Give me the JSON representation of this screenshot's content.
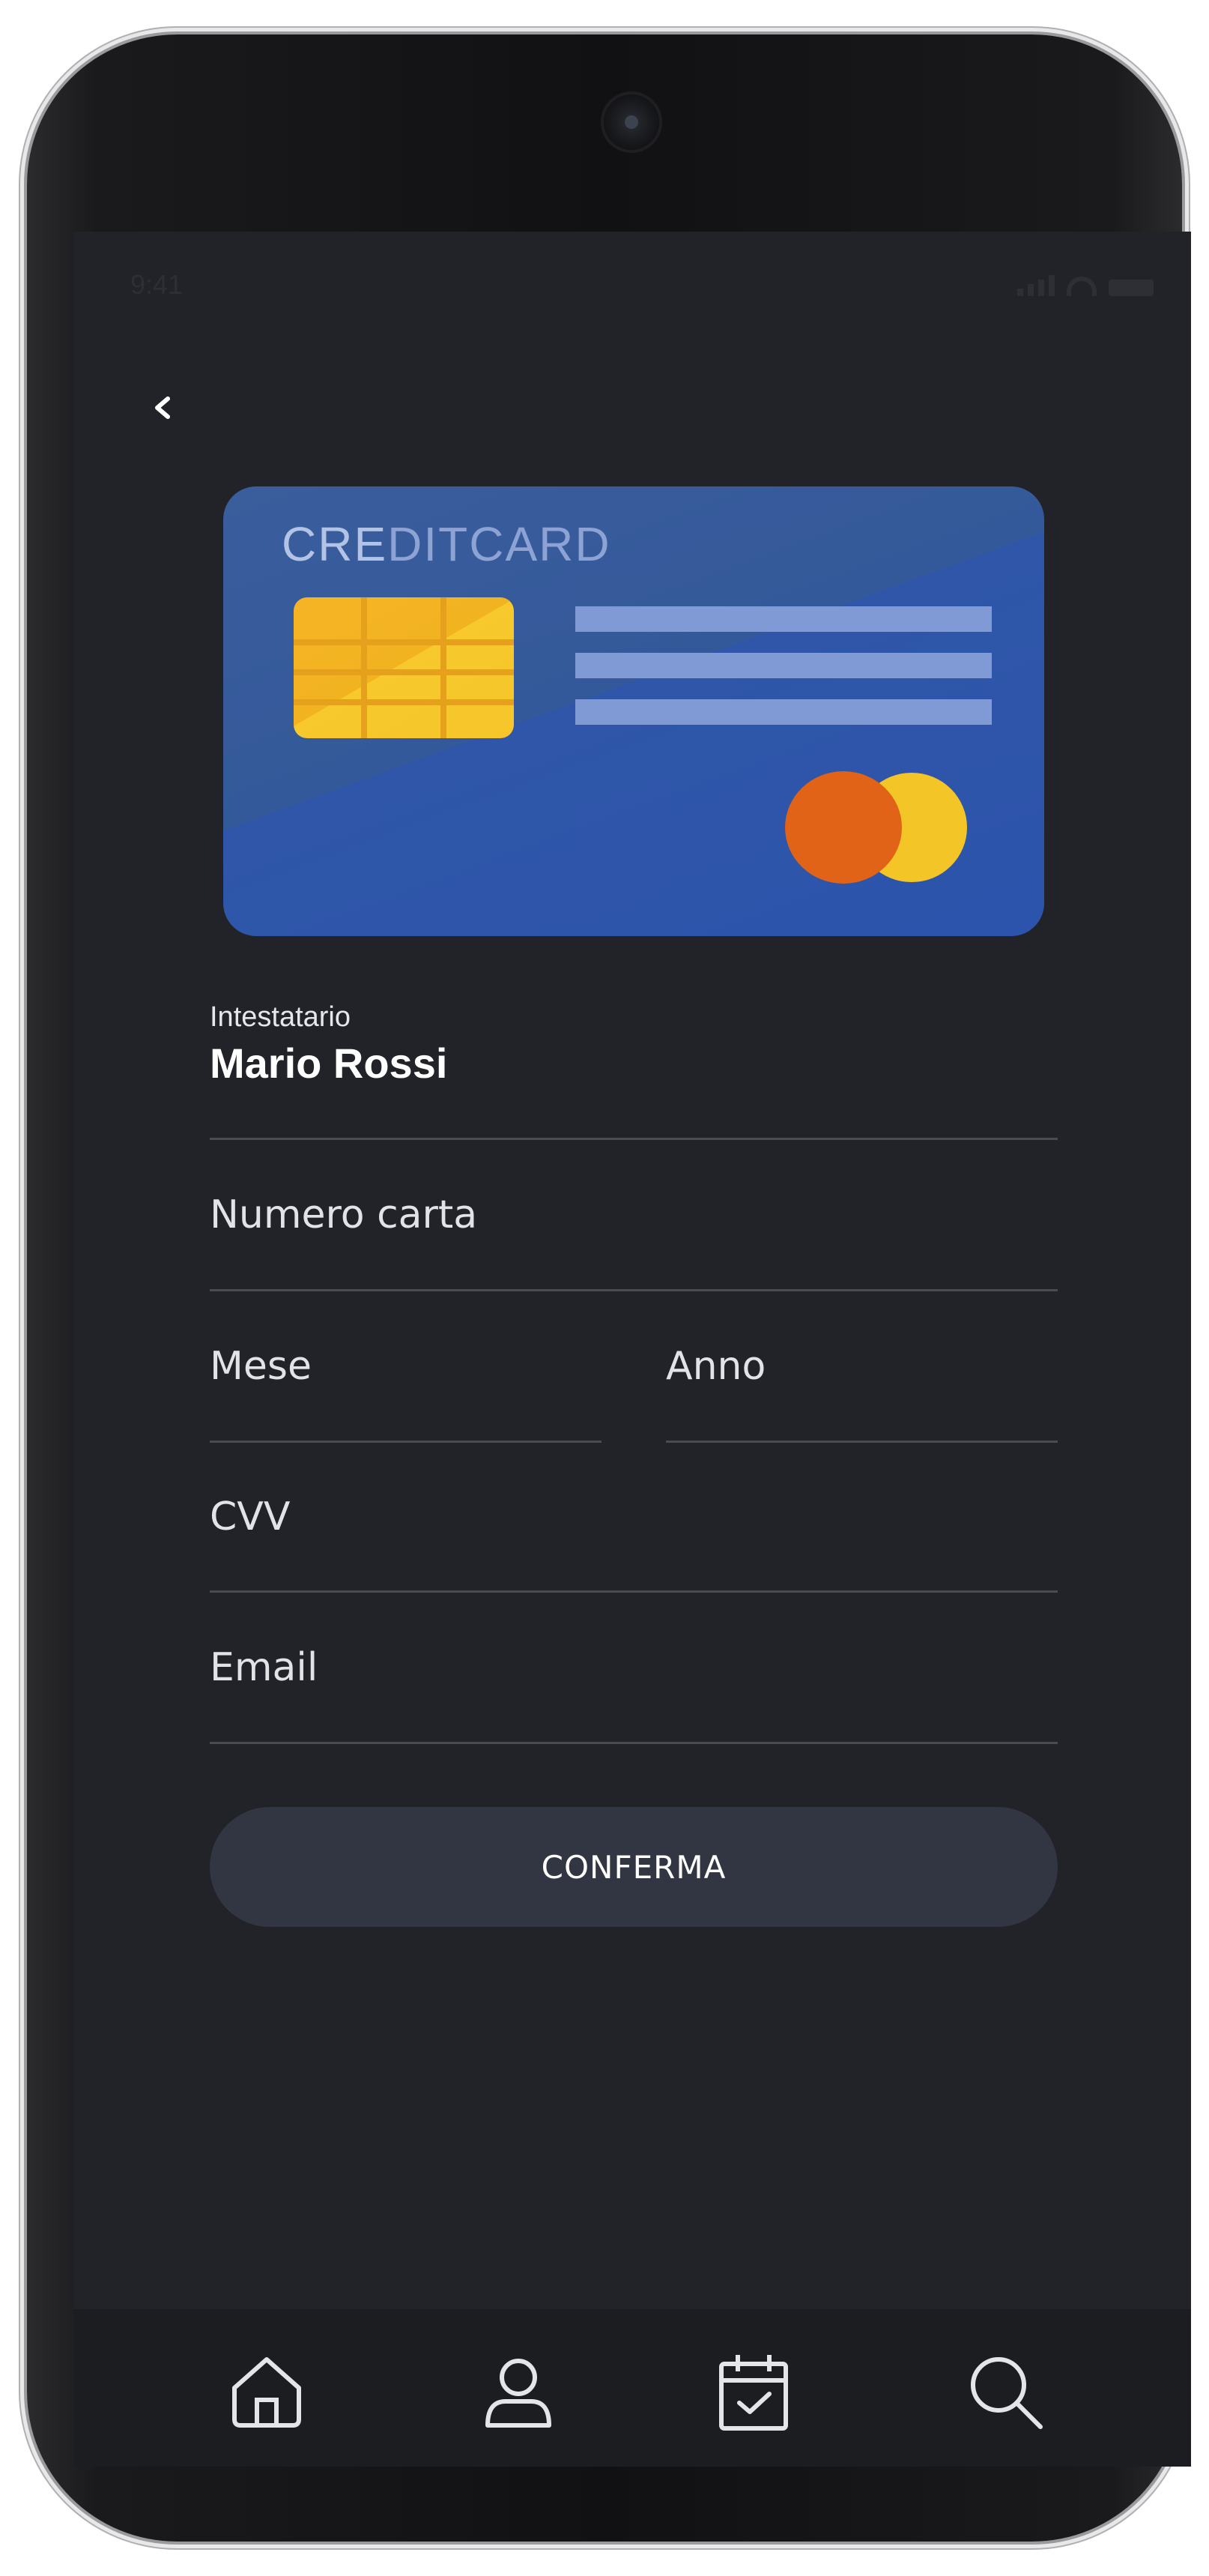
{
  "status_bar": {
    "time": "9:41"
  },
  "nav": {
    "back_icon": "chevron-left-icon"
  },
  "card": {
    "title_highlight": "CRE",
    "title_rest": "DITCARD"
  },
  "form": {
    "holder_label": "Intestatario",
    "holder_value": "Mario Rossi",
    "card_number_placeholder": "Numero carta",
    "month_placeholder": "Mese",
    "year_placeholder": "Anno",
    "cvv_placeholder": "CVV",
    "email_placeholder": "Email",
    "confirm_label": "CONFERMA"
  },
  "tabbar": {
    "items": [
      "home-icon",
      "user-icon",
      "calendar-check-icon",
      "search-icon"
    ]
  },
  "colors": {
    "screen_bg": "#222328",
    "card_blue": "#2f56a8",
    "button_bg": "#323642",
    "tabbar_bg": "#1c1d21"
  }
}
